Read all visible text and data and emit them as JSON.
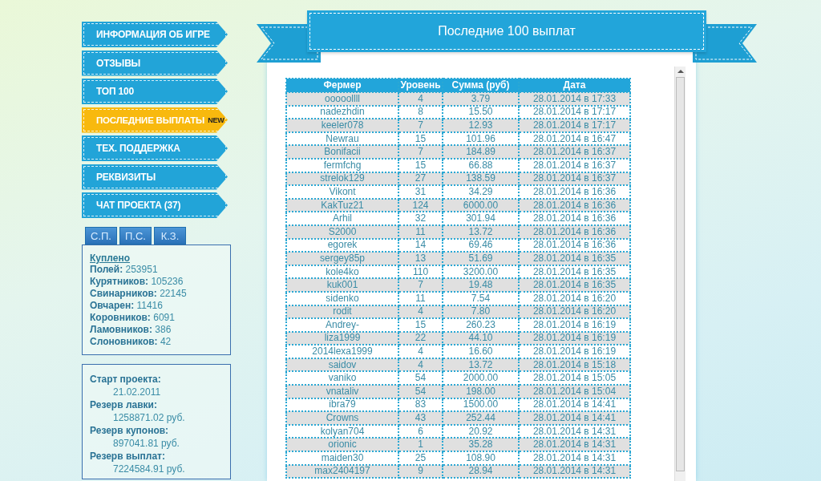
{
  "nav": [
    {
      "label": "ИНФОРМАЦИЯ ОБ ИГРЕ",
      "selected": false
    },
    {
      "label": "ОТЗЫВЫ",
      "selected": false
    },
    {
      "label": "ТОП 100",
      "selected": false
    },
    {
      "label": "ПОСЛЕДНИЕ ВЫПЛАТЫ",
      "badge": "NEW",
      "selected": true
    },
    {
      "label": "ТЕХ. ПОДДЕРЖКА",
      "selected": false
    },
    {
      "label": "РЕКВИЗИТЫ",
      "selected": false
    },
    {
      "label": "ЧАТ ПРОЕКТА (37)",
      "selected": false
    }
  ],
  "tabs": [
    {
      "label": "С.П."
    },
    {
      "label": "П.С."
    },
    {
      "label": "К.З."
    }
  ],
  "purchased": {
    "heading": "Куплено",
    "items": [
      {
        "label": "Полей:",
        "value": "253951"
      },
      {
        "label": "Курятников:",
        "value": "105236"
      },
      {
        "label": "Свинарников:",
        "value": "22145"
      },
      {
        "label": "Овчарен:",
        "value": "11416"
      },
      {
        "label": "Коровников:",
        "value": "6091"
      },
      {
        "label": "Ламовников:",
        "value": "386"
      },
      {
        "label": "Слоновников:",
        "value": "42"
      }
    ]
  },
  "project": [
    {
      "label": "Старт проекта:",
      "value": "21.02.2011"
    },
    {
      "label": "Резерв лавки:",
      "value": "1258871.02 руб."
    },
    {
      "label": "Резерв купонов:",
      "value": "897041.81 руб."
    },
    {
      "label": "Резерв выплат:",
      "value": "7224584.91 руб."
    }
  ],
  "title": "Последние 100 выплат",
  "table": {
    "columns": [
      "Фермер",
      "Уровень",
      "Сумма (руб)",
      "Дата"
    ],
    "rows": [
      [
        "ooooollll",
        "4",
        "3.79",
        "28.01.2014 в 17:33"
      ],
      [
        "nadezhdin",
        "8",
        "15.50",
        "28.01.2014 в 17:17"
      ],
      [
        "keeler078",
        "7",
        "12.93",
        "28.01.2014 в 17:17"
      ],
      [
        "Newrau",
        "15",
        "101.96",
        "28.01.2014 в 16:47"
      ],
      [
        "Bonifacii",
        "7",
        "184.89",
        "28.01.2014 в 16:37"
      ],
      [
        "fermfchg",
        "15",
        "66.88",
        "28.01.2014 в 16:37"
      ],
      [
        "strelok129",
        "27",
        "138.59",
        "28.01.2014 в 16:37"
      ],
      [
        "Vikont",
        "31",
        "34.29",
        "28.01.2014 в 16:36"
      ],
      [
        "KakTuz21",
        "124",
        "6000.00",
        "28.01.2014 в 16:36"
      ],
      [
        "Arhil",
        "32",
        "301.94",
        "28.01.2014 в 16:36"
      ],
      [
        "S2000",
        "11",
        "13.72",
        "28.01.2014 в 16:36"
      ],
      [
        "egorek",
        "14",
        "69.46",
        "28.01.2014 в 16:36"
      ],
      [
        "sergey85p",
        "13",
        "51.69",
        "28.01.2014 в 16:35"
      ],
      [
        "kole4ko",
        "110",
        "3200.00",
        "28.01.2014 в 16:35"
      ],
      [
        "kuk001",
        "7",
        "19.48",
        "28.01.2014 в 16:35"
      ],
      [
        "sidenko",
        "11",
        "7.54",
        "28.01.2014 в 16:20"
      ],
      [
        "rodit",
        "4",
        "7.80",
        "28.01.2014 в 16:20"
      ],
      [
        "Andrey-",
        "15",
        "260.23",
        "28.01.2014 в 16:19"
      ],
      [
        "liza1999",
        "22",
        "44.10",
        "28.01.2014 в 16:19"
      ],
      [
        "2014lexa1999",
        "4",
        "16.60",
        "28.01.2014 в 16:19"
      ],
      [
        "saidov",
        "4",
        "13.72",
        "28.01.2014 в 15:18"
      ],
      [
        "vaniko",
        "54",
        "2000.00",
        "28.01.2014 в 15:05"
      ],
      [
        "vnataliv",
        "54",
        "198.00",
        "28.01.2014 в 15:04"
      ],
      [
        "ibra79",
        "83",
        "1500.00",
        "28.01.2014 в 14:41"
      ],
      [
        "Crowns",
        "43",
        "252.44",
        "28.01.2014 в 14:41"
      ],
      [
        "kolyan704",
        "6",
        "20.92",
        "28.01.2014 в 14:31"
      ],
      [
        "orionic",
        "1",
        "35.28",
        "28.01.2014 в 14:31"
      ],
      [
        "maiden30",
        "25",
        "108.90",
        "28.01.2014 в 14:31"
      ],
      [
        "max2404197",
        "9",
        "28.94",
        "28.01.2014 в 14:31"
      ]
    ]
  }
}
